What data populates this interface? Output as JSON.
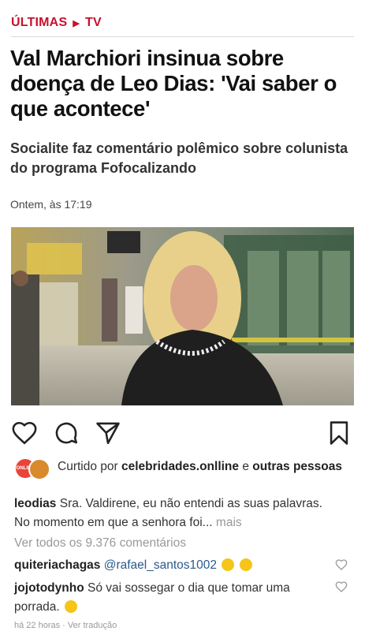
{
  "breadcrumb": {
    "section": "ÚLTIMAS",
    "subsection": "TV"
  },
  "article": {
    "headline": "Val Marchiori insinua sobre doença de Leo Dias: 'Vai saber o que acontece'",
    "subtitle": "Socialite faz comentário polêmico sobre colunista do programa Fofocalizando",
    "timestamp": "Ontem, às 17:19"
  },
  "post": {
    "avatar_label": "ONLINE",
    "likes_prefix": "Curtido por",
    "likes_user": "celebridades.onlline",
    "likes_conj": "e",
    "likes_suffix": "outras pessoas",
    "caption": {
      "user": "leodias",
      "text": "Sra. Valdirene, eu não entendi as suas palavras. No momento em que a senhora foi...",
      "more": "mais"
    },
    "view_all": "Ver todos os 9.376 comentários",
    "comments": [
      {
        "user": "quiteriachagas",
        "text": "@rafael_santos1002"
      },
      {
        "user": "jojotodynho",
        "text": "Só  vai sossegar o dia que  tomar uma porrada."
      }
    ],
    "footer": "há 22 horas · Ver tradução"
  },
  "colors": {
    "accent": "#c8102e",
    "text": "#111111",
    "muted": "#999999"
  }
}
